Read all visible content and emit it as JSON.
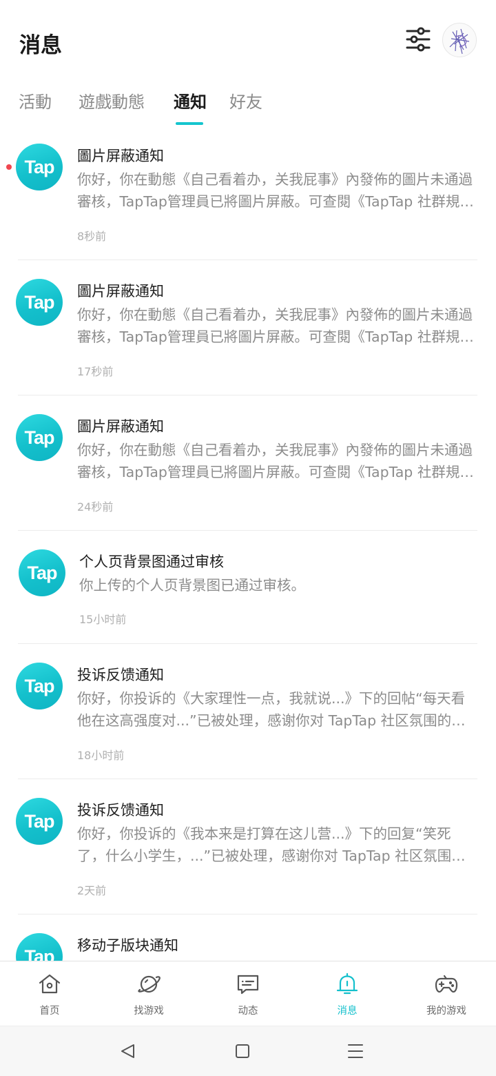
{
  "header": {
    "title": "消息"
  },
  "tabs": [
    {
      "label": "活動",
      "active": false
    },
    {
      "label": "遊戲動態",
      "active": false
    },
    {
      "label": "通知",
      "active": true
    },
    {
      "label": "好友",
      "active": false
    }
  ],
  "notifications": [
    {
      "logo": "Tap",
      "title": "圖片屏蔽通知",
      "body": "你好，你在動態《自己看着办，关我屁事》內發佈的圖片未通過審核，TapTap管理員已將圖片屏蔽。可查閱《TapTap 社群規範》",
      "time": "8秒前",
      "unread": true
    },
    {
      "logo": "Tap",
      "title": "圖片屏蔽通知",
      "body": "你好，你在動態《自己看着办，关我屁事》內發佈的圖片未通過審核，TapTap管理員已將圖片屏蔽。可查閱《TapTap 社群規範》",
      "time": "17秒前",
      "unread": false
    },
    {
      "logo": "Tap",
      "title": "圖片屏蔽通知",
      "body": "你好，你在動態《自己看着办，关我屁事》內發佈的圖片未通過審核，TapTap管理員已將圖片屏蔽。可查閱《TapTap 社群規範》",
      "time": "24秒前",
      "unread": false
    },
    {
      "logo": "Tap",
      "title": "个人页背景图通过审核",
      "body": "你上传的个人页背景图已通过审核。",
      "time": "15小时前",
      "unread": false
    },
    {
      "logo": "Tap",
      "title": "投诉反馈通知",
      "body": "你好，你投诉的《大家理性一点，我就说...》下的回帖“每天看他在这高强度对...”已被处理，感谢你对 TapTap 社区氛围的维护",
      "time": "18小时前",
      "unread": false
    },
    {
      "logo": "Tap",
      "title": "投诉反馈通知",
      "body": "你好，你投诉的《我本来是打算在这儿营...》下的回复“笑死了，什么小学生，...”已被处理，感谢你对 TapTap 社区氛围的维护",
      "time": "2天前",
      "unread": false
    },
    {
      "logo": "Tap",
      "title": "移动子版块通知",
      "body": "",
      "time": "",
      "unread": false
    }
  ],
  "bottom_nav": [
    {
      "label": "首页",
      "icon": "home-icon",
      "active": false
    },
    {
      "label": "找游戏",
      "icon": "planet-icon",
      "active": false
    },
    {
      "label": "动态",
      "icon": "chat-icon",
      "active": false
    },
    {
      "label": "消息",
      "icon": "bell-icon",
      "active": true
    },
    {
      "label": "我的游戏",
      "icon": "gamepad-icon",
      "active": false
    }
  ],
  "colors": {
    "accent": "#14c0cc",
    "unread": "#f0464f",
    "text_primary": "#1f1f1f",
    "text_secondary": "#8c8c8c",
    "text_time": "#b0b0b0"
  }
}
